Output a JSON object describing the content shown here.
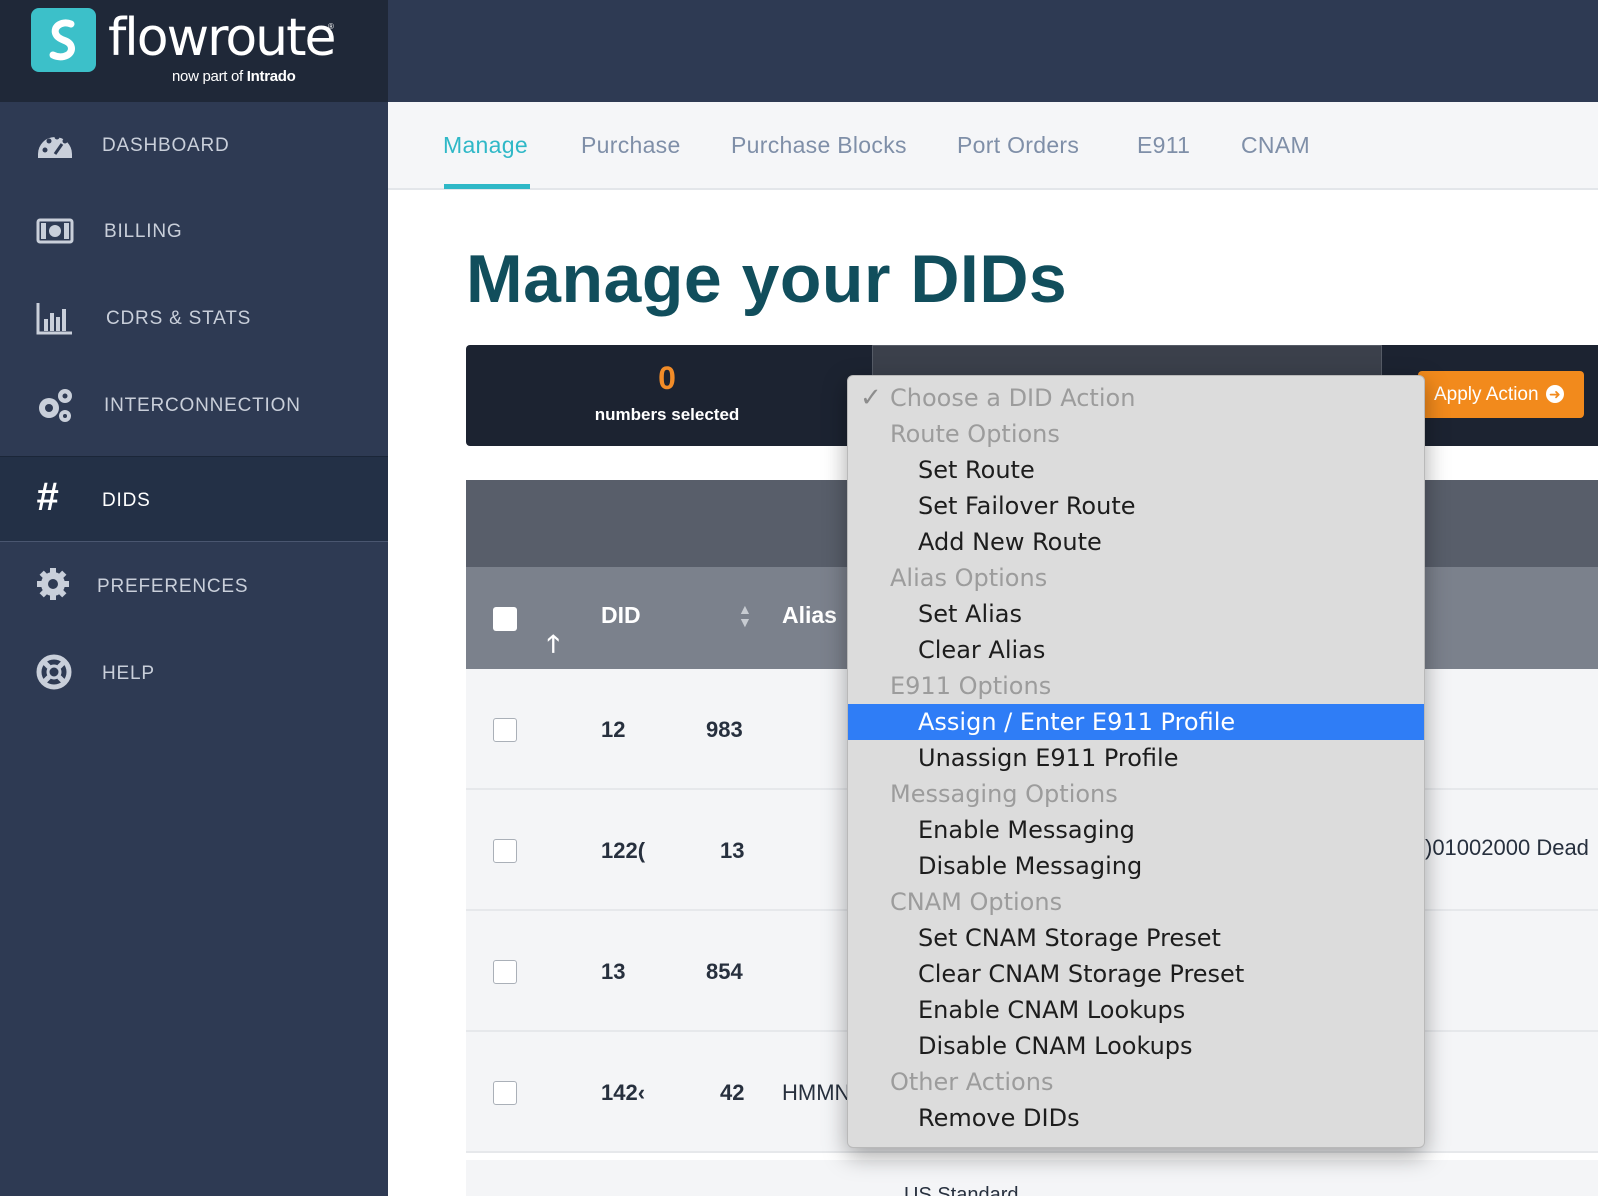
{
  "brand": {
    "name": "flowroute",
    "registered": "®",
    "tagline_prefix": "now part of",
    "tagline_company": "Intrado"
  },
  "sidebar": {
    "items": [
      {
        "label": "DASHBOARD",
        "icon": "dashboard-icon"
      },
      {
        "label": "BILLING",
        "icon": "billing-icon"
      },
      {
        "label": "CDRS & STATS",
        "icon": "bar-chart-icon"
      },
      {
        "label": "INTERCONNECTION",
        "icon": "gears-icon"
      },
      {
        "label": "DIDS",
        "icon": "hash-icon",
        "active": true
      },
      {
        "label": "PREFERENCES",
        "icon": "gear-icon"
      },
      {
        "label": "HELP",
        "icon": "life-ring-icon"
      }
    ]
  },
  "tabs": [
    "Manage",
    "Purchase",
    "Purchase Blocks",
    "Port Orders",
    "E911",
    "CNAM"
  ],
  "active_tab": "Manage",
  "page_title": "Manage your DIDs",
  "selection": {
    "count": "0",
    "label": "numbers selected"
  },
  "apply_action": {
    "label": "Apply Action",
    "icon": "arrow-right-circle-icon"
  },
  "table": {
    "headers": {
      "did": "DID",
      "alias": "Alias"
    },
    "rows": [
      {
        "did_a": "12",
        "did_b": "983",
        "alias": "",
        "extra": ""
      },
      {
        "did_a": "122(",
        "did_b": "13",
        "alias": "",
        "extra": ")01002000 Dead"
      },
      {
        "did_a": "13",
        "did_b": "854",
        "alias": "",
        "extra": ""
      },
      {
        "did_a": "142‹",
        "did_b": "42",
        "alias": "HMMN",
        "extra": ""
      }
    ],
    "partial_row_text": "US Standard"
  },
  "did_action_dropdown": {
    "selected": "Choose a DID Action",
    "highlighted": "Assign / Enter E911 Profile",
    "groups": [
      {
        "label": "Route Options",
        "options": [
          "Set Route",
          "Set Failover Route",
          "Add New Route"
        ]
      },
      {
        "label": "Alias Options",
        "options": [
          "Set Alias",
          "Clear Alias"
        ]
      },
      {
        "label": "E911 Options",
        "options": [
          "Assign / Enter E911 Profile",
          "Unassign E911 Profile"
        ]
      },
      {
        "label": "Messaging Options",
        "options": [
          "Enable Messaging",
          "Disable Messaging"
        ]
      },
      {
        "label": "CNAM Options",
        "options": [
          "Set CNAM Storage Preset",
          "Clear CNAM Storage Preset",
          "Enable CNAM Lookups",
          "Disable CNAM Lookups"
        ]
      },
      {
        "label": "Other Actions",
        "options": [
          "Remove DIDs"
        ]
      }
    ]
  },
  "colors": {
    "sidebar_bg": "#2e3a53",
    "accent_teal": "#2fb8c7",
    "title_teal": "#114e5c",
    "count_orange": "#f28c28",
    "apply_orange": "#f28a1c",
    "dropdown_highlight": "#2f7df6"
  }
}
